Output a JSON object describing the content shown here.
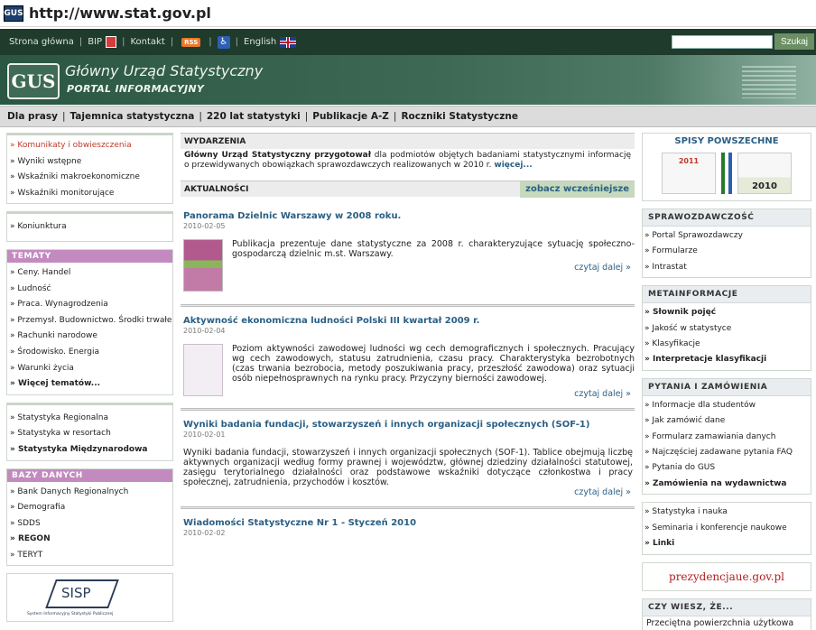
{
  "url_bar": {
    "icon": "site-favicon-icon",
    "url": "http://www.stat.gov.pl"
  },
  "top_nav": {
    "items": [
      "Strona główna",
      "BIP",
      "Kontakt",
      "RSS",
      "English"
    ],
    "search_button": "Szukaj",
    "search_value": ""
  },
  "banner": {
    "logo": "GUS",
    "title": "Główny Urząd Statystyczny",
    "subtitle": "PORTAL INFORMACYJNY"
  },
  "sub_nav": [
    "Dla prasy",
    "Tajemnica statystyczna",
    "220 lat statystyki",
    "Publikacje A-Z",
    "Roczniki Statystyczne"
  ],
  "left": {
    "box1": [
      "Komunikaty i obwieszczenia",
      "Wyniki wstępne",
      "Wskaźniki makroekonomiczne",
      "Wskaźniki monitorujące"
    ],
    "box2": [
      "Koniunktura"
    ],
    "tematy_head": "TEMATY",
    "tematy": [
      "Ceny. Handel",
      "Ludność",
      "Praca. Wynagrodzenia",
      "Przemysł. Budownictwo. Środki trwałe",
      "Rachunki narodowe",
      "Środowisko. Energia",
      "Warunki życia",
      "Więcej tematów..."
    ],
    "regional": [
      "Statystyka Regionalna",
      "Statystyka w resortach",
      "Statystyka Międzynarodowa"
    ],
    "bazy_head": "BAZY DANYCH",
    "bazy": [
      "Bank Danych Regionalnych",
      "Demografia",
      "SDDS",
      "REGON",
      "TERYT"
    ],
    "sisp": "SISP",
    "sisp_sub": "System Informacyjny Statystyki Publicznej"
  },
  "center": {
    "wydarzenia_head": "WYDARZENIA",
    "wydarzenia_bold": "Główny Urząd Statystyczny przygotował",
    "wydarzenia_text": " dla podmiotów objętych badaniami statystycznymi informację o przewidywanych obowiązkach sprawozdawczych realizowanych w 2010 r. ",
    "wydarzenia_more": "więcej...",
    "aktualnosci_head": "AKTUALNOŚCI",
    "aktualnosci_more": "zobacz wcześniejsze",
    "news": [
      {
        "title": "Panorama Dzielnic Warszawy w 2008 roku.",
        "date": "2010-02-05",
        "text": "Publikacja prezentuje dane statystyczne za 2008 r. charakteryzujące sytuację społeczno-gospodarczą dzielnic m.st. Warszawy.",
        "read": "czytaj dalej »"
      },
      {
        "title": "Aktywność ekonomiczna ludności Polski III kwartał 2009 r.",
        "date": "2010-02-04",
        "text": "Poziom aktywności zawodowej ludności wg cech demograficznych i społecznych. Pracujący wg cech zawodowych, statusu zatrudnienia, czasu pracy. Charakterystyka bezrobotnych (czas trwania bezrobocia, metody poszukiwania pracy, przeszłość zawodowa) oraz sytuacji osób niepełnosprawnych na rynku pracy. Przyczyny bierności zawodowej.",
        "read": "czytaj dalej »"
      },
      {
        "title": "Wyniki badania fundacji, stowarzyszeń i innych organizacji społecznych (SOF-1)",
        "date": "2010-02-01",
        "text": "Wyniki badania fundacji, stowarzyszeń i innych organizacji społecznych (SOF-1). Tablice obejmują liczbę aktywnych organizacji według formy prawnej i województw, głównej dziedziny działalności statutowej, zasięgu terytorialnego działalności oraz podstawowe wskaźniki dotyczące członkostwa i pracy społecznej, zatrudnienia, przychodów i kosztów.",
        "read": "czytaj dalej »"
      },
      {
        "title": "Wiadomości Statystyczne Nr 1 - Styczeń 2010",
        "date": "2010-02-02"
      }
    ]
  },
  "right": {
    "spisy_title": "SPISY POWSZECHNE",
    "spisy_years": [
      "2011",
      "2010"
    ],
    "spraw_head": "SPRAWOZDAWCZOŚĆ",
    "spraw": [
      "Portal Sprawozdawczy",
      "Formularze",
      "Intrastat"
    ],
    "meta_head": "METAINFORMACJE",
    "meta": [
      "Słownik pojęć",
      "Jakość w statystyce",
      "Klasyfikacje",
      "Interpretacje klasyfikacji"
    ],
    "pyt_head": "PYTANIA I ZAMÓWIENIA",
    "pyt": [
      "Informacje dla studentów",
      "Jak zamówić dane",
      "Formularz zamawiania danych",
      "Najczęściej zadawane pytania FAQ",
      "Pytania do GUS",
      "Zamówienia na wydawnictwa"
    ],
    "misc": [
      "Statystyka i nauka",
      "Seminaria i konferencje naukowe",
      "Linki"
    ],
    "prez": "prezydencjaue.gov.pl",
    "wiesz_head": "CZY WIESZ, ŻE...",
    "wiesz_text": "Przeciętna powierzchnia użytkowa"
  }
}
